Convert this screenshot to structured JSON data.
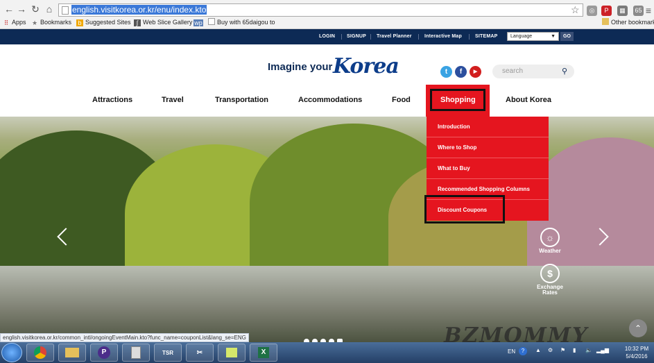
{
  "browser": {
    "url": "english.visitkorea.or.kr/enu/index.kto",
    "bookmarks": [
      "Apps",
      "Bookmarks",
      "Suggested Sites",
      "Web Slice Gallery",
      "Buy with 65daigou to",
      "Other bookmarks"
    ],
    "extension_badge": "65",
    "status_url": "english.visitkorea.or.kr/common_intl/ongoingEventMain.kto?func_name=couponList&lang_se=ENG"
  },
  "topbar": {
    "links": [
      "LOGIN",
      "SIGNUP",
      "Travel Planner",
      "Interactive Map",
      "SITEMAP"
    ],
    "language": "Language",
    "go": "GO"
  },
  "header": {
    "logo_text": "Imagine your",
    "logo_brand": "Korea",
    "search_placeholder": "search",
    "social": [
      "t",
      "f",
      "▶"
    ]
  },
  "nav": {
    "items": [
      "Attractions",
      "Travel",
      "Transportation",
      "Accommodations",
      "Food",
      "Shopping",
      "About Korea"
    ]
  },
  "dropdown": {
    "items": [
      "Introduction",
      "Where to Shop",
      "What to Buy",
      "Recommended Shopping Columns",
      "Discount Coupons"
    ]
  },
  "quicklinks": [
    "Weather",
    "Exchange Rates"
  ],
  "watermark": "BZMOMMY",
  "taskbar": {
    "lang": "EN",
    "time": "10:32 PM",
    "date": "5/4/2016",
    "apps": [
      "TSR"
    ]
  },
  "colors": {
    "navy": "#0d2a55",
    "accent_red": "#e5151f"
  }
}
